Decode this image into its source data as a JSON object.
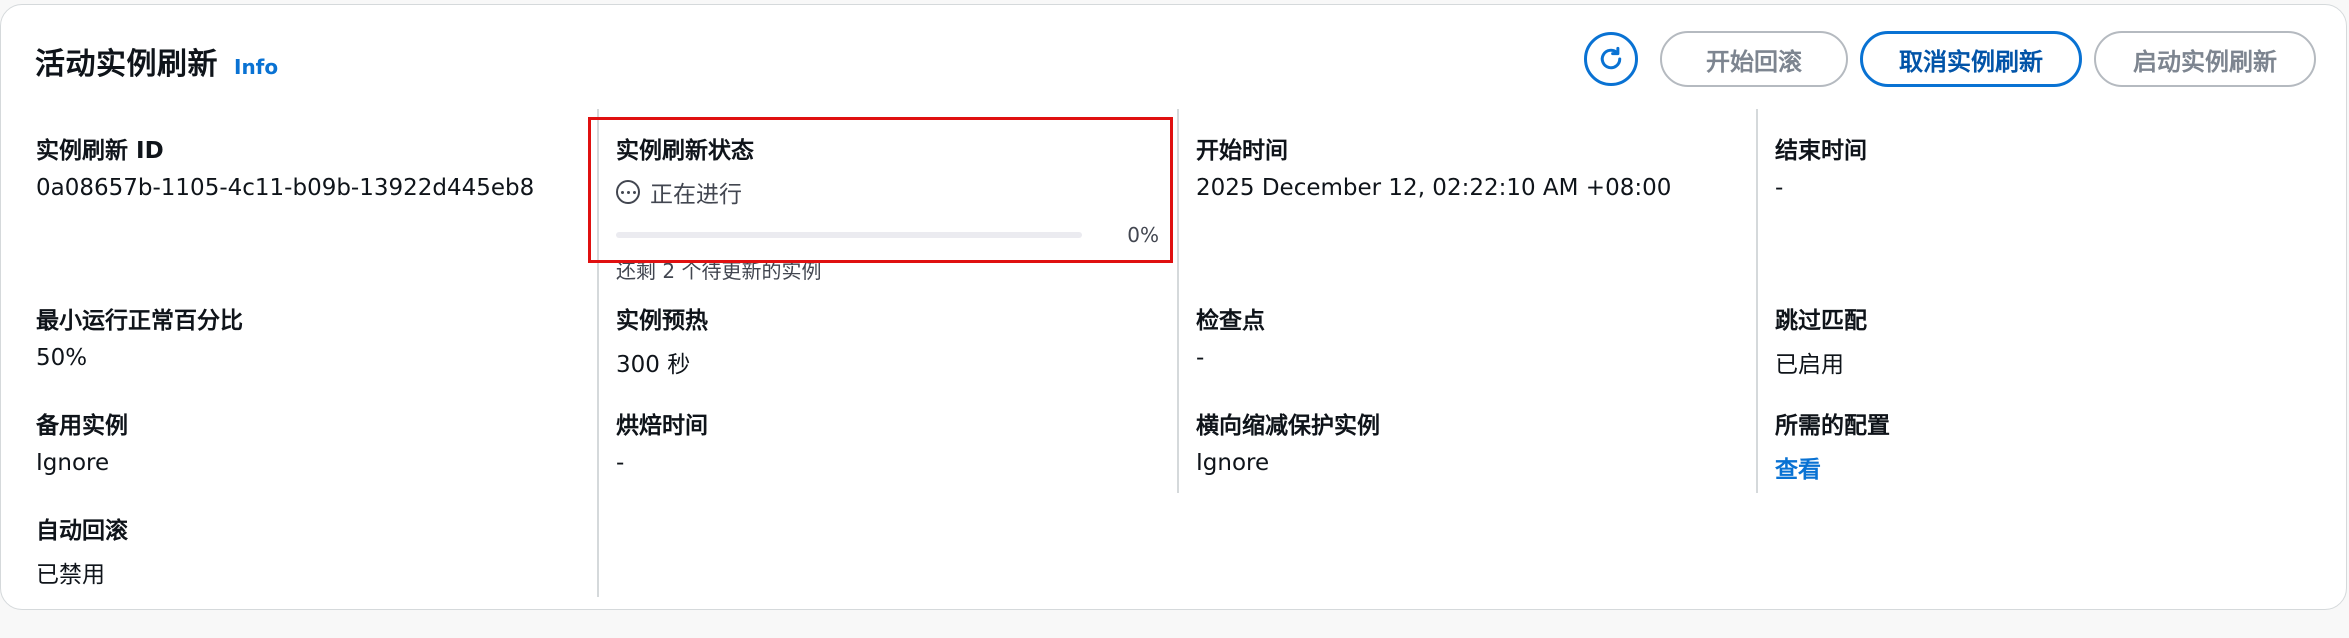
{
  "header": {
    "title": "活动实例刷新",
    "info": "Info"
  },
  "actions": {
    "refresh_icon": "refresh-icon",
    "start_rollback": "开始回滚",
    "cancel_refresh": "取消实例刷新",
    "start_refresh": "启动实例刷新"
  },
  "fields": {
    "refresh_id": {
      "label": "实例刷新 ID",
      "value": "0a08657b-1105-4c11-b09b-13922d445eb8"
    },
    "status": {
      "label": "实例刷新状态",
      "value": "正在进行",
      "progress_pct_text": "0%",
      "progress": 0,
      "progress_desc": "还剩 2 个待更新的实例",
      "icon": "in-progress-icon"
    },
    "start_time": {
      "label": "开始时间",
      "value": "2025 December 12, 02:22:10 AM +08:00"
    },
    "end_time": {
      "label": "结束时间",
      "value": "-"
    },
    "min_healthy": {
      "label": "最小运行正常百分比",
      "value": "50%"
    },
    "warmup": {
      "label": "实例预热",
      "value": "300 秒"
    },
    "checkpoint": {
      "label": "检查点",
      "value": "-"
    },
    "skip_matching": {
      "label": "跳过匹配",
      "value": "已启用"
    },
    "standby": {
      "label": "备用实例",
      "value": "Ignore"
    },
    "bake_time": {
      "label": "烘焙时间",
      "value": "-"
    },
    "scale_in_protection": {
      "label": "横向缩减保护实例",
      "value": "Ignore"
    },
    "desired_config": {
      "label": "所需的配置",
      "value": "查看"
    },
    "auto_rollback": {
      "label": "自动回滚",
      "value": "已禁用"
    }
  },
  "colors": {
    "accent": "#0972d3",
    "highlight": "#e01010"
  }
}
